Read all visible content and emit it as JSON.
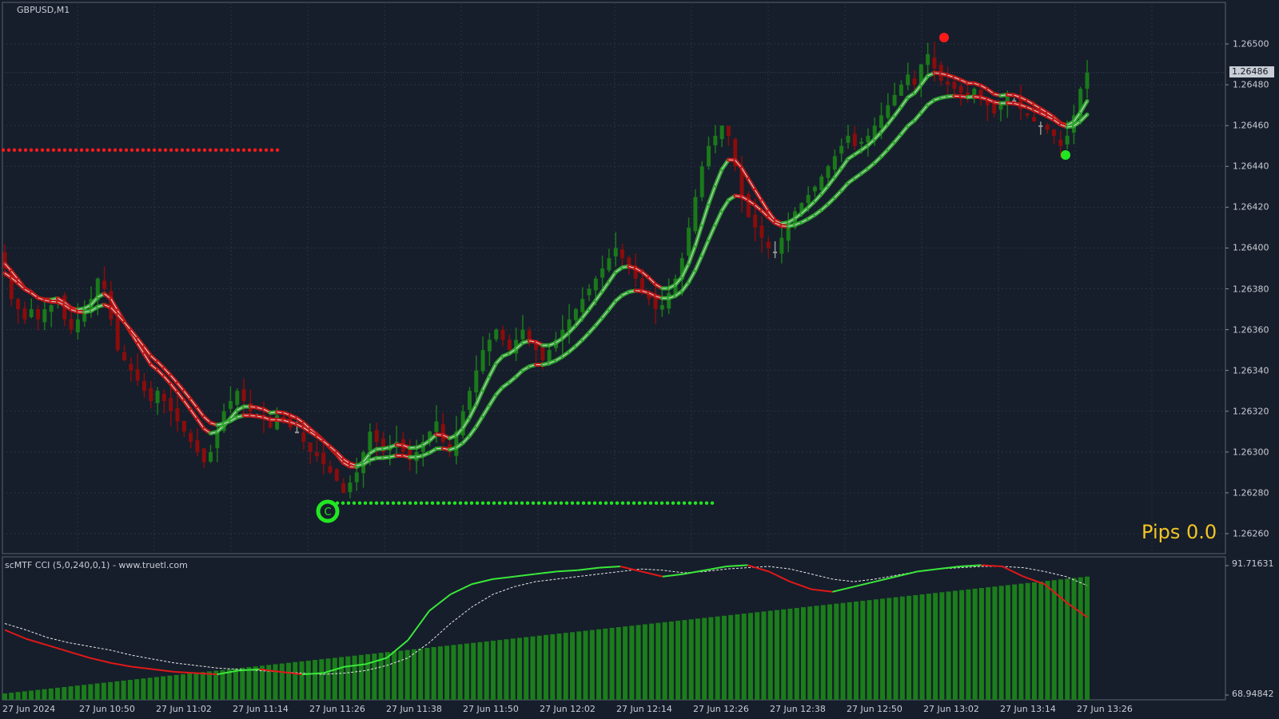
{
  "window": {
    "symbol_title": "GBPUSD,M1",
    "pips_label": "Pips 0.0",
    "current_price": "1.26486"
  },
  "price_axis": {
    "labels": [
      "1.26500",
      "1.26480",
      "1.26460",
      "1.26440",
      "1.26420",
      "1.26400",
      "1.26380",
      "1.26360",
      "1.26340",
      "1.26320",
      "1.26300",
      "1.26280",
      "1.26260"
    ]
  },
  "cci_panel": {
    "title": "scMTF CCI (5,0,240,0,1) - www.truetl.com",
    "max_label": "91.71631",
    "min_label": "68.94842"
  },
  "time_axis": {
    "labels": [
      "27 Jun 2024",
      "27 Jun 10:50",
      "27 Jun 11:02",
      "27 Jun 11:14",
      "27 Jun 11:26",
      "27 Jun 11:38",
      "27 Jun 11:50",
      "27 Jun 12:02",
      "27 Jun 12:14",
      "27 Jun 12:26",
      "27 Jun 12:38",
      "27 Jun 12:50",
      "27 Jun 13:02",
      "27 Jun 13:14",
      "27 Jun 13:26"
    ]
  },
  "colors": {
    "background": "#161e2b",
    "bull": "#1a7a1a",
    "bear": "#8b0c0c",
    "neutral": "#9a9a9a",
    "signal_up": "#22e622",
    "signal_down": "#ff1a1a",
    "grid": "#283344",
    "axis_text": "#c9cdd5",
    "pips_text": "#f4c524"
  },
  "chart_data": {
    "type": "candlestick",
    "symbol": "GBPUSD",
    "timeframe": "M1",
    "ylim": [
      1.2625,
      1.2651
    ],
    "closes": [
      1.2639,
      1.26375,
      1.2637,
      1.26365,
      1.2637,
      1.26365,
      1.2637,
      1.26372,
      1.26375,
      1.26365,
      1.2636,
      1.26365,
      1.2637,
      1.26375,
      1.26385,
      1.2638,
      1.26365,
      1.2635,
      1.26345,
      1.2634,
      1.26335,
      1.2633,
      1.26325,
      1.2633,
      1.26325,
      1.2632,
      1.26315,
      1.2631,
      1.26305,
      1.263,
      1.26295,
      1.263,
      1.2631,
      1.2632,
      1.26325,
      1.2633,
      1.26325,
      1.2632,
      1.26318,
      1.26316,
      1.26312,
      1.26318,
      1.26316,
      1.26312,
      1.2631,
      1.26305,
      1.263,
      1.26298,
      1.26294,
      1.2629,
      1.26286,
      1.2628,
      1.26285,
      1.2629,
      1.263,
      1.2631,
      1.26305,
      1.263,
      1.26302,
      1.26305,
      1.263,
      1.26296,
      1.263,
      1.26305,
      1.2631,
      1.26315,
      1.26305,
      1.263,
      1.2631,
      1.2632,
      1.2633,
      1.2634,
      1.2635,
      1.26355,
      1.2636,
      1.26355,
      1.2635,
      1.26355,
      1.2636,
      1.26355,
      1.2635,
      1.26345,
      1.2635,
      1.26355,
      1.2636,
      1.26365,
      1.2637,
      1.26375,
      1.2638,
      1.26385,
      1.2639,
      1.26395,
      1.264,
      1.26395,
      1.2639,
      1.26385,
      1.2638,
      1.26375,
      1.2637,
      1.26372,
      1.26378,
      1.26385,
      1.26395,
      1.2641,
      1.26425,
      1.2644,
      1.2645,
      1.26455,
      1.2646,
      1.26455,
      1.2644,
      1.26425,
      1.26415,
      1.2641,
      1.26405,
      1.264,
      1.26398,
      1.26405,
      1.26412,
      1.26418,
      1.26422,
      1.26426,
      1.2643,
      1.26435,
      1.2644,
      1.26445,
      1.2645,
      1.26455,
      1.2645,
      1.26452,
      1.26455,
      1.2646,
      1.26465,
      1.2647,
      1.26475,
      1.2648,
      1.26485,
      1.2648,
      1.2649,
      1.26495,
      1.26488,
      1.26482,
      1.2648,
      1.26478,
      1.26476,
      1.26474,
      1.26478,
      1.26474,
      1.2647,
      1.26466,
      1.2647,
      1.26474,
      1.26472,
      1.26468,
      1.26465,
      1.26462,
      1.2646,
      1.26458,
      1.26455,
      1.2645,
      1.26455,
      1.26465,
      1.26478,
      1.26486
    ],
    "signals": [
      {
        "type": "buy",
        "price": 1.26275
      },
      {
        "type": "sell",
        "price": 1.26503
      },
      {
        "type": "buy",
        "price": 1.26445
      }
    ],
    "levels": [
      {
        "type": "resistance-dotted",
        "price": 1.26448
      },
      {
        "type": "support-dotted",
        "price": 1.26275
      }
    ],
    "cci": {
      "ylim": [
        68.94842,
        91.71631
      ],
      "max": 91.71631,
      "min": 68.94842
    }
  }
}
